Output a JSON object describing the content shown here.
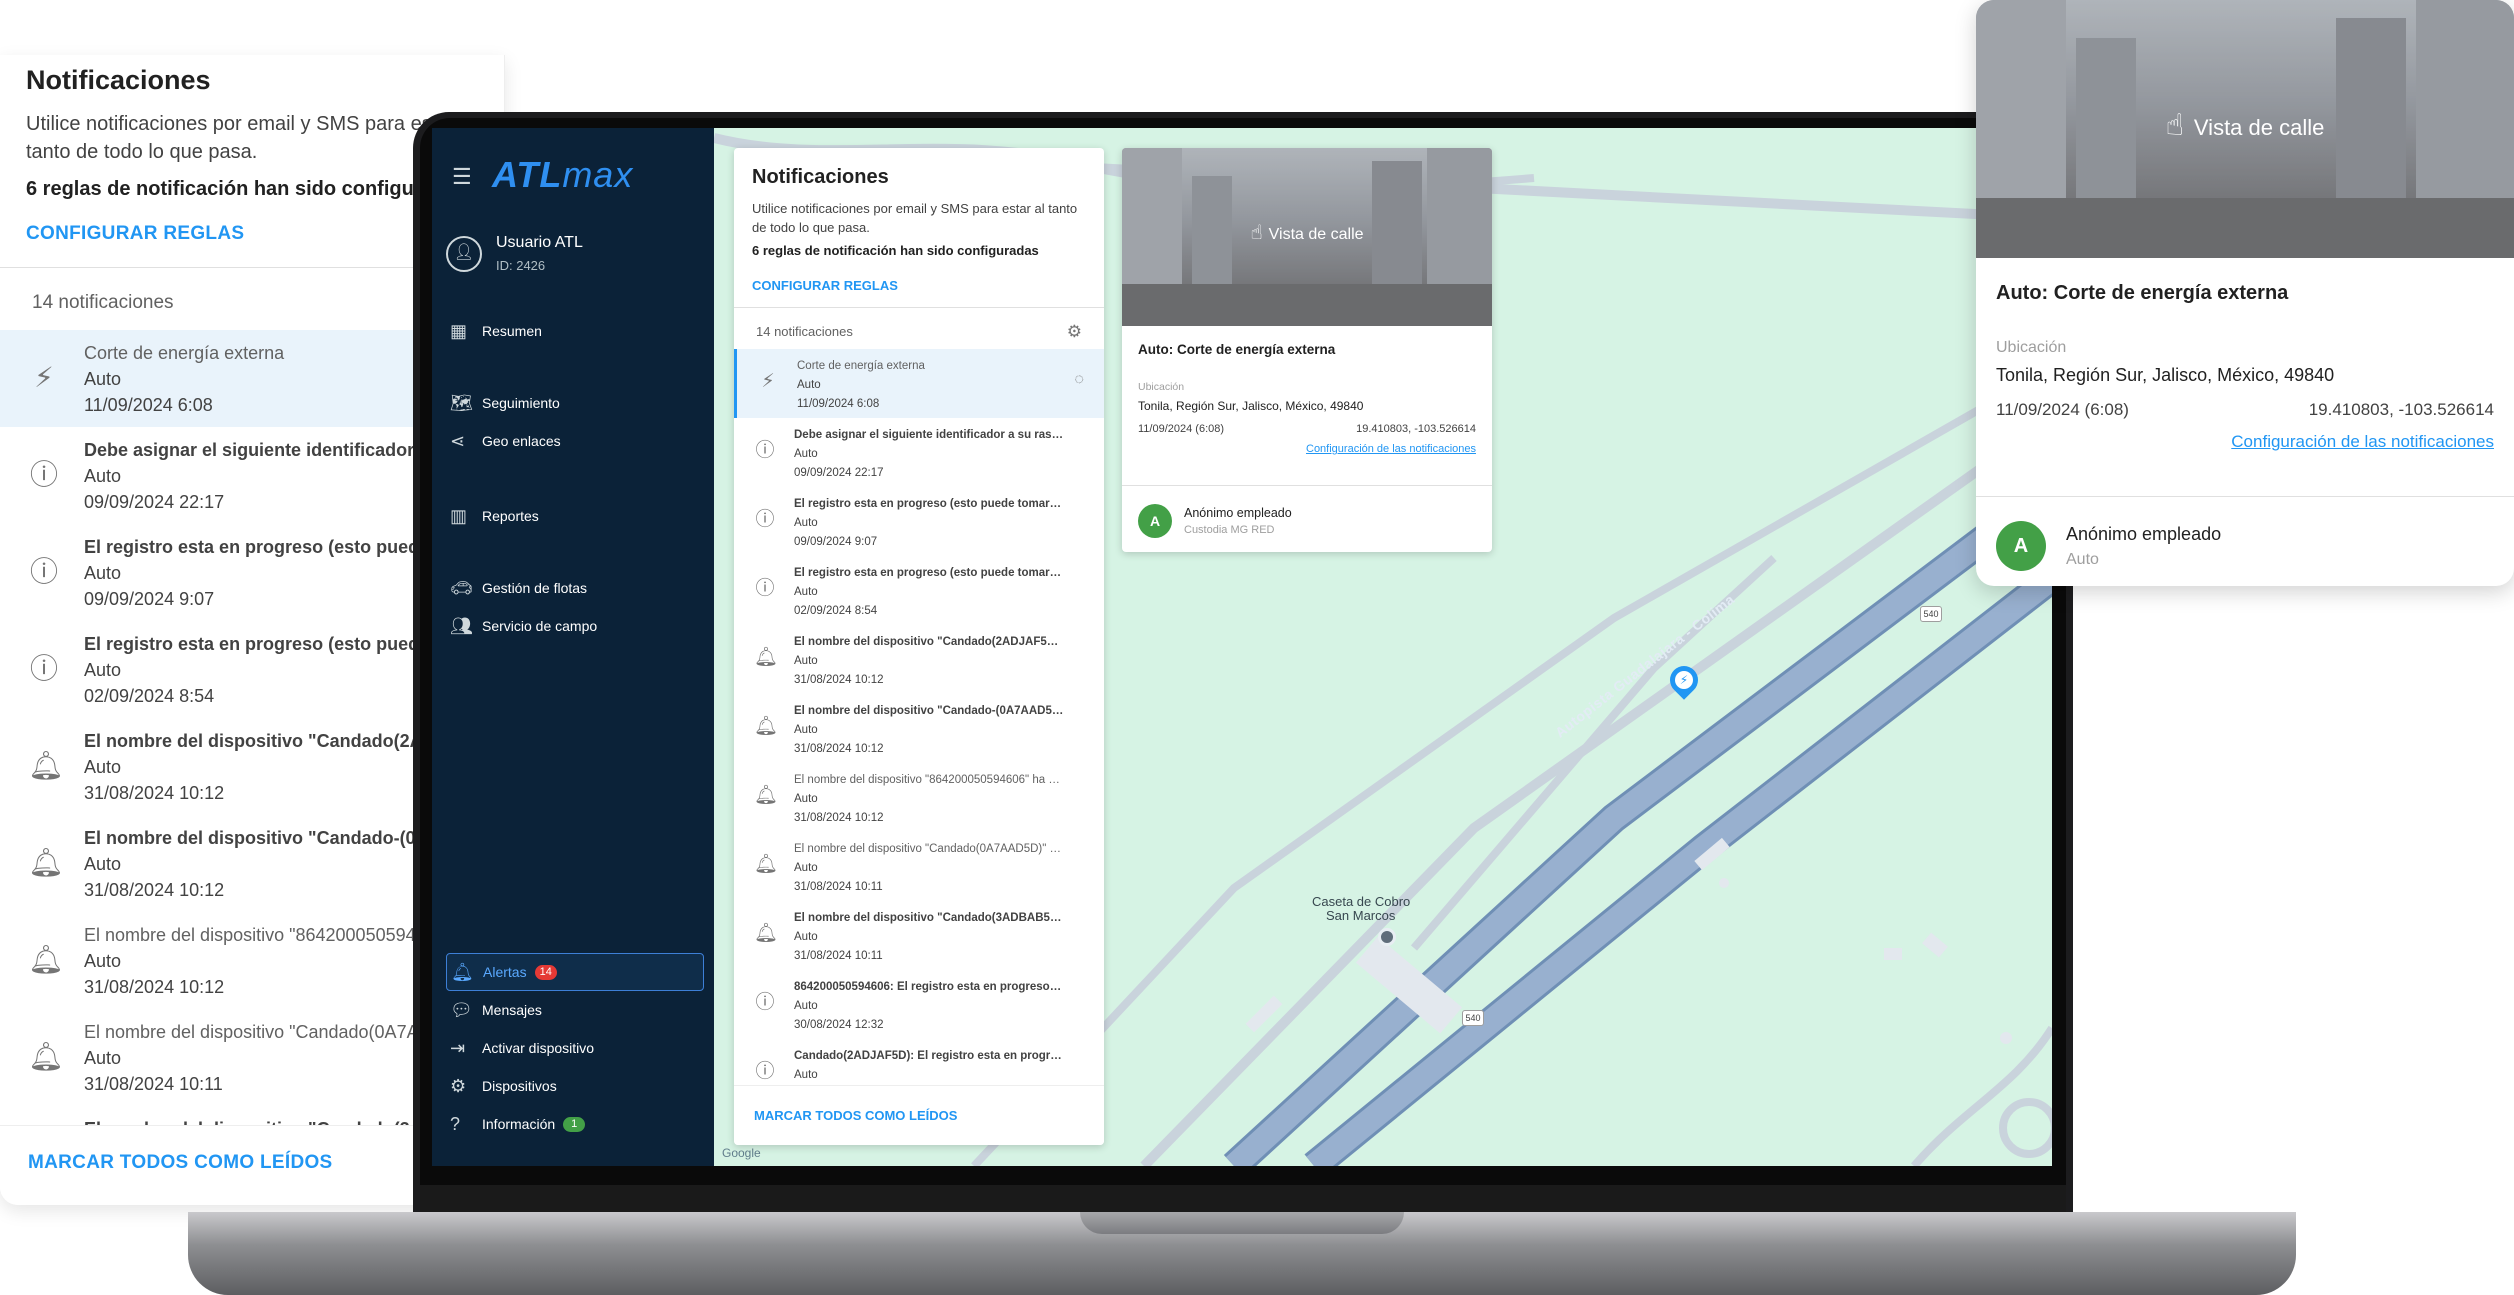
{
  "notifications_panel": {
    "title": "Notificaciones",
    "description": "Utilice notificaciones por email y SMS para estar al tanto de todo lo que pasa.",
    "rules_configured": "6 reglas de notificación han sido configuradas",
    "configure_rules": "CONFIGURAR REGLAS",
    "count_label": "14 notificaciones",
    "mark_all_read": "MARCAR TODOS COMO LEÍDOS",
    "items": [
      {
        "title": "Corte de energía externa",
        "source": "Auto",
        "date": "11/09/2024 6:08",
        "icon": "power-off-icon",
        "read": true
      },
      {
        "title": "Debe asignar el siguiente identificador a su rastreador...",
        "source": "Auto",
        "date": "09/09/2024 22:17",
        "icon": "info-icon",
        "read": false
      },
      {
        "title": "El registro esta en progreso (esto puede tomar de 2-3 ...",
        "source": "Auto",
        "date": "09/09/2024 9:07",
        "icon": "info-icon",
        "read": false
      },
      {
        "title": "El registro esta en progreso (esto puede tomar de 2-3 ...",
        "source": "Auto",
        "date": "02/09/2024 8:54",
        "icon": "info-icon",
        "read": false
      },
      {
        "title": "El nombre del dispositivo \"Candado(2ADJAF5D)\" ha sid...",
        "source": "Auto",
        "date": "31/08/2024 10:12",
        "icon": "bell-icon",
        "read": false
      },
      {
        "title": "El nombre del dispositivo \"Candado-(0A7AAD5D)\" ha si...",
        "source": "Auto",
        "date": "31/08/2024 10:12",
        "icon": "bell-icon",
        "read": false
      },
      {
        "title": "El nombre del dispositivo \"864200050594606\" ha sido c...",
        "source": "Auto",
        "date": "31/08/2024 10:12",
        "icon": "bell-icon",
        "read": true
      },
      {
        "title": "El nombre del dispositivo \"Candado(0A7AAD5D)\" ha si...",
        "source": "Auto",
        "date": "31/08/2024 10:11",
        "icon": "bell-icon",
        "read": true
      },
      {
        "title": "El nombre del dispositivo \"Candado(3ADBAB5D)\" ha sid...",
        "source": "Auto",
        "date": "31/08/2024 10:11",
        "icon": "bell-icon",
        "read": false
      },
      {
        "title": "864200050594606: El registro esta en progreso (esto p...",
        "source": "Auto",
        "date": "30/08/2024 12:32",
        "icon": "info-icon",
        "read": false
      },
      {
        "title": "Candado(2ADJAF5D): El registro esta en progreso (est...",
        "source": "Auto",
        "date": "",
        "icon": "info-icon",
        "read": false
      }
    ]
  },
  "enlarged_left": {
    "titles": [
      "Corte de energía externa",
      "Debe asignar el siguiente identificador a su ra",
      "El registro esta en progreso (esto puede tomar",
      "El registro esta en progreso (esto puede tomar",
      "El nombre del dispositivo \"Candado(2ADJAF5",
      "El nombre del dispositivo \"Candado-(0A7AAD",
      "El nombre del dispositivo \"864200050594606\"",
      "El nombre del dispositivo \"Candado(0A7AAD5",
      "El nombre del dispositivo \"Candado(3ADBAB5"
    ],
    "desc_line1": "Utilice notificaciones por email y SMS para estar",
    "desc_line2": "tanto de todo lo que pasa.",
    "rules": "6 reglas de notificación han sido configuradas"
  },
  "sidebar": {
    "logo_a": "ATL",
    "logo_b": "max",
    "user_name": "Usuario ATL",
    "user_id": "ID: 2426",
    "items": {
      "resumen": "Resumen",
      "seguimiento": "Seguimiento",
      "geo": "Geo enlaces",
      "reportes": "Reportes",
      "flotas": "Gestión de flotas",
      "campo": "Servicio de campo",
      "alertas": "Alertas",
      "alertas_badge": "14",
      "mensajes": "Mensajes",
      "activar": "Activar dispositivo",
      "dispositivos": "Dispositivos",
      "informacion": "Información",
      "informacion_badge": "1"
    }
  },
  "detail_card": {
    "street_view_label": "Vista de calle",
    "title": "Auto: Corte de energía externa",
    "location_label": "Ubicación",
    "address": "Tonila, Región Sur, Jalisco, México, 49840",
    "datetime": "11/09/2024 (6:08)",
    "coords": "19.410803, -103.526614",
    "config_link": "Configuración de las notificaciones",
    "employee_initial": "A",
    "employee_name": "Anónimo empleado",
    "employee_role": "Custodia MG RED",
    "enlarged_employee_role": "Auto"
  },
  "map": {
    "toll_label_1": "Caseta de Cobro",
    "toll_label_2": "San Marcos",
    "highway_label": "Autopista Guadalajara - Colima",
    "route_shield": "540",
    "attribution": "Google"
  },
  "colors": {
    "sidebar_bg": "#0b2238",
    "accent": "#2196f3",
    "map_bg": "#d6f3e4",
    "road": "#8fa8c8",
    "badge_red": "#e53935",
    "badge_green": "#43a047"
  }
}
